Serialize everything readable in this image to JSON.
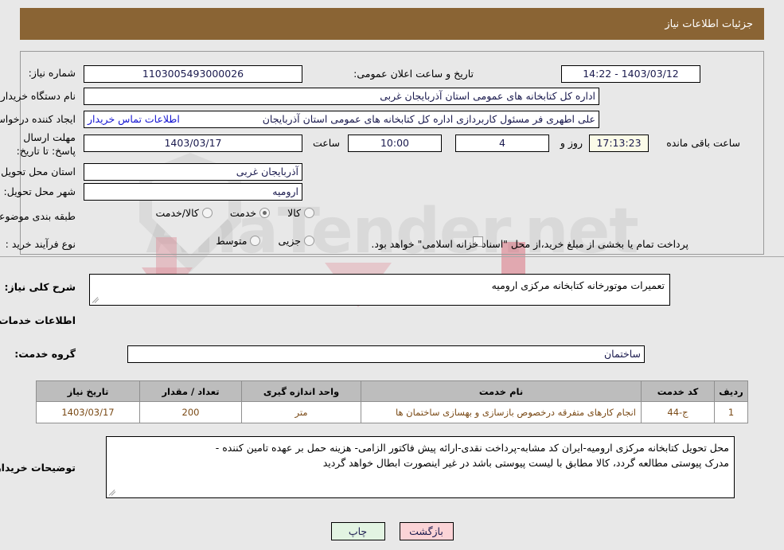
{
  "header": {
    "title": "جزئیات اطلاعات نیاز"
  },
  "form": {
    "need_number_label": "شماره نیاز:",
    "need_number_value": "1103005493000026",
    "announce_label": "تاریخ و ساعت اعلان عمومی:",
    "announce_value": "1403/03/12 - 14:22",
    "buyer_org_label": "نام دستگاه خریدار:",
    "buyer_org_value": "اداره کل کتابخانه های عمومی استان آذربایجان غربی",
    "requester_label": "ایجاد کننده درخواست:",
    "requester_value": "علی اطهری فر مسئول کاربردازی اداره کل کتابخانه های عمومی استان آذربایجان",
    "contact_link": "اطلاعات تماس خریدار",
    "deadline_label": "مهلت ارسال پاسخ: تا تاریخ:",
    "deadline_date": "1403/03/17",
    "deadline_hour_label": "ساعت",
    "deadline_hour": "10:00",
    "remaining_days": "4",
    "remaining_days_label": "روز و",
    "remaining_time": "17:13:23",
    "remaining_time_label": "ساعت باقی مانده",
    "province_label": "استان محل تحویل:",
    "province_value": "آذربایجان غربی",
    "city_label": "شهر محل تحویل:",
    "city_value": "ارومیه",
    "category_label": "طبقه بندی موضوعی:",
    "category_options": [
      {
        "label": "کالا",
        "selected": false
      },
      {
        "label": "خدمت",
        "selected": true
      },
      {
        "label": "کالا/خدمت",
        "selected": false
      }
    ],
    "process_label": "نوع فرآیند خرید :",
    "process_options": [
      {
        "label": "جزیی",
        "selected": false
      },
      {
        "label": "متوسط",
        "selected": false
      }
    ],
    "treasury_checkbox_checked": false,
    "treasury_note": "پرداخت تمام یا بخشی از مبلغ خرید،از محل \"اسناد خزانه اسلامی\" خواهد بود."
  },
  "description": {
    "label": "شرح کلی نیاز:",
    "value": "تعمیرات موتورخانه کتابخانه مرکزی ارومیه"
  },
  "services": {
    "section_title": "اطلاعات خدمات مورد نیاز",
    "group_label": "گروه خدمت:",
    "group_value": "ساختمان",
    "columns": [
      "ردیف",
      "کد خدمت",
      "نام خدمت",
      "واحد اندازه گیری",
      "تعداد / مقدار",
      "تاریخ نیاز"
    ],
    "rows": [
      {
        "row": "1",
        "code": "ج-44",
        "name": "انجام کارهای متفرقه درخصوص بازسازی و بهسازی ساختمان ها",
        "unit": "متر",
        "quantity": "200",
        "date": "1403/03/17"
      }
    ]
  },
  "buyer_notes": {
    "label": "توضیحات خریدار:",
    "line1": "محل تحویل کتابخانه مرکزی ارومیه-ایران کد مشابه-پرداخت نقدی-ارائه پیش فاکتور الزامی- هزینه حمل بر عهده تامین کننده -",
    "line2": "مدرک پیوستی مطالعه گردد، کالا مطابق با لیست پیوستی باشد در غیر اینصورت ابطال خواهد گردید"
  },
  "footer": {
    "print_label": "چاپ",
    "back_label": "بازگشت"
  },
  "watermark": {
    "text": "AnaTender.net"
  },
  "colors": {
    "header_bar": "#8a6434",
    "page_bg": "#e8e8e8",
    "link": "#1414d2",
    "field_text": "#1a1a4e",
    "table_header": "#bdbdbd",
    "table_text": "#7a4a16",
    "countdown_bg": "#fbfbe8",
    "print_btn": "#e2f4e2",
    "back_btn": "#fbd3d6"
  }
}
